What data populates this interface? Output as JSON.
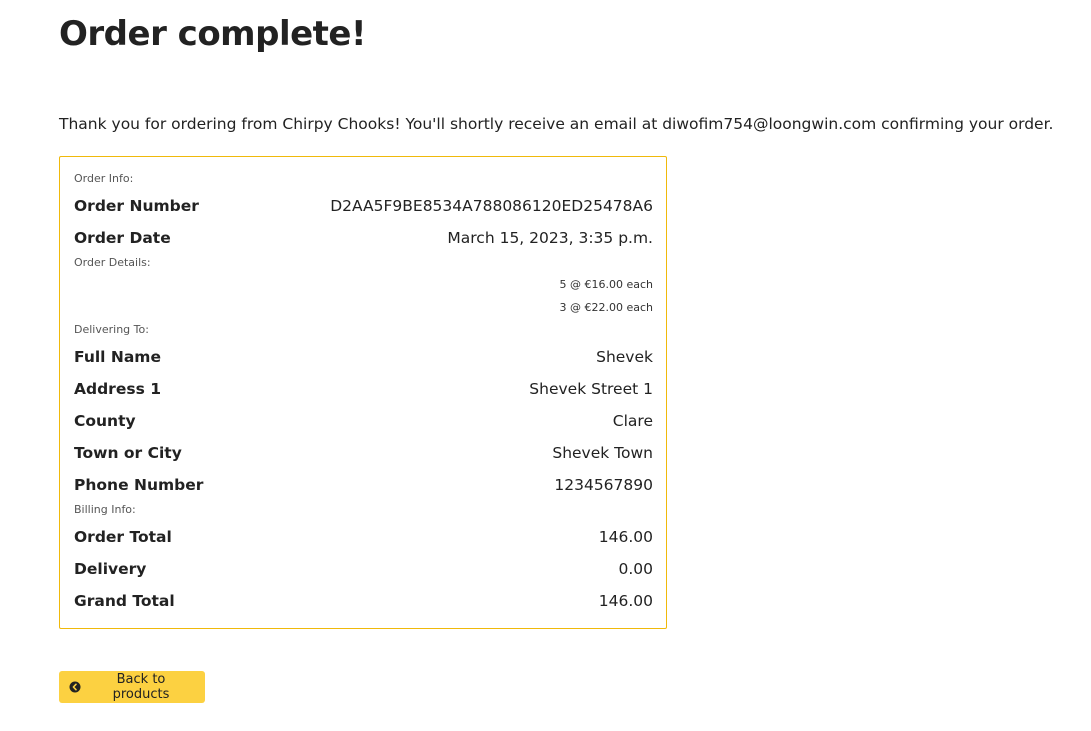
{
  "page": {
    "title": "Order complete!",
    "thank_you_message": "Thank you for ordering from Chirpy Chooks! You'll shortly receive an email at diwofim754@loongwin.com confirming your order."
  },
  "order_info": {
    "label": "Order Info:",
    "order_number_key": "Order Number",
    "order_number": "D2AA5F9BE8534A788086120ED25478A6",
    "order_date_key": "Order Date",
    "order_date": "March 15, 2023, 3:35 p.m."
  },
  "order_details": {
    "label": "Order Details:",
    "items": [
      "5 @ €16.00 each",
      "3 @ €22.00 each"
    ]
  },
  "delivering_to": {
    "label": "Delivering To:",
    "full_name_key": "Full Name",
    "full_name": "Shevek",
    "address1_key": "Address 1",
    "address1": "Shevek Street 1",
    "county_key": "County",
    "county": "Clare",
    "town_key": "Town or City",
    "town": "Shevek Town",
    "phone_key": "Phone Number",
    "phone": "1234567890"
  },
  "billing_info": {
    "label": "Billing Info:",
    "order_total_key": "Order Total",
    "order_total": "146.00",
    "delivery_key": "Delivery",
    "delivery": "0.00",
    "grand_total_key": "Grand Total",
    "grand_total": "146.00"
  },
  "actions": {
    "back_label": "Back to products",
    "back_icon": "chevron-circle-left-icon"
  },
  "colors": {
    "accent": "#fcd141",
    "box_border": "#f0b90b",
    "text": "#222222"
  }
}
